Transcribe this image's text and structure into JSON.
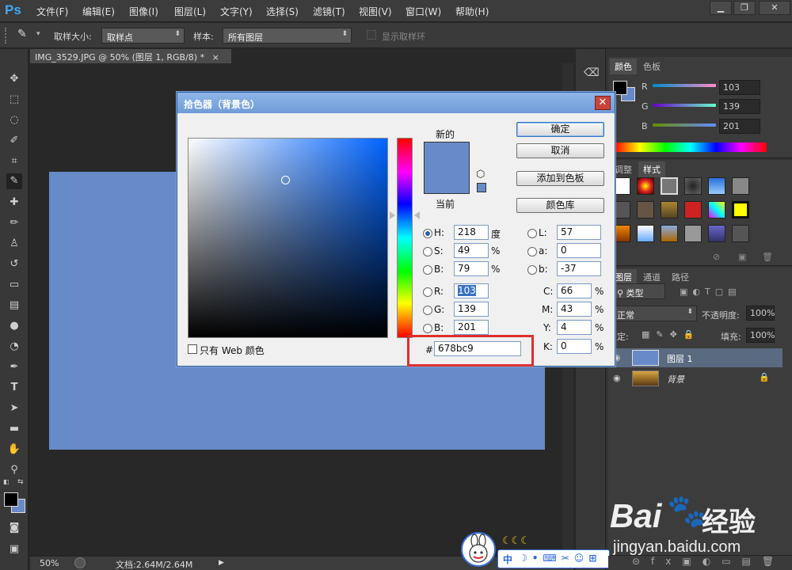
{
  "app": {
    "logo": "Ps",
    "menu": [
      "文件(F)",
      "编辑(E)",
      "图像(I)",
      "图层(L)",
      "文字(Y)",
      "选择(S)",
      "滤镜(T)",
      "视图(V)",
      "窗口(W)",
      "帮助(H)"
    ],
    "window_buttons": [
      "▁",
      "❐",
      "✕"
    ]
  },
  "options_bar": {
    "sample_size_label": "取样大小:",
    "sample_size_value": "取样点",
    "sample_label": "样本:",
    "sample_value": "所有图层",
    "show_ring_label": "显示取样环"
  },
  "document": {
    "tab_title": "IMG_3529.JPG @ 50% (图层 1, RGB/8) *",
    "tab_close": "×",
    "fill_color": "#678bc9",
    "zoom": "50%",
    "doc_info": "文档:2.64M/2.64M"
  },
  "color_panel": {
    "tabs": [
      "颜色",
      "色板"
    ],
    "channels": [
      {
        "label": "R",
        "value": "103"
      },
      {
        "label": "G",
        "value": "139"
      },
      {
        "label": "B",
        "value": "201"
      }
    ]
  },
  "styles_panel": {
    "tabs": [
      "调整",
      "样式"
    ]
  },
  "layers_panel": {
    "tabs": [
      "图层",
      "通道",
      "路径"
    ],
    "filter": "类型",
    "blend_mode": "正常",
    "opacity_label": "不透明度:",
    "opacity": "100%",
    "lock_label": "锁定:",
    "fill_label": "填充:",
    "fill": "100%",
    "layers": [
      {
        "name": "图层 1",
        "selected": true
      },
      {
        "name": "背景",
        "selected": false
      }
    ]
  },
  "color_picker": {
    "title": "拾色器（背景色）",
    "close": "✕",
    "new_label": "新的",
    "current_label": "当前",
    "new_color": "#678bc9",
    "current_color": "#678bc9",
    "buttons": {
      "ok": "确定",
      "cancel": "取消",
      "add_swatch": "添加到色板",
      "color_library": "颜色库"
    },
    "hsb": [
      {
        "label": "H:",
        "value": "218",
        "unit": "度",
        "selected": true
      },
      {
        "label": "S:",
        "value": "49",
        "unit": "%",
        "selected": false
      },
      {
        "label": "B:",
        "value": "79",
        "unit": "%",
        "selected": false
      }
    ],
    "rgb": [
      {
        "label": "R:",
        "value": "103"
      },
      {
        "label": "G:",
        "value": "139"
      },
      {
        "label": "B:",
        "value": "201"
      }
    ],
    "lab": [
      {
        "label": "L:",
        "value": "57"
      },
      {
        "label": "a:",
        "value": "0"
      },
      {
        "label": "b:",
        "value": "-37"
      }
    ],
    "cmyk": [
      {
        "label": "C:",
        "value": "66",
        "unit": "%"
      },
      {
        "label": "M:",
        "value": "43",
        "unit": "%"
      },
      {
        "label": "Y:",
        "value": "4",
        "unit": "%"
      },
      {
        "label": "K:",
        "value": "0",
        "unit": "%"
      }
    ],
    "hex_label": "#",
    "hex": "678bc9",
    "web_only_label": "只有 Web 颜色"
  },
  "watermark": {
    "ime_text": "中",
    "baidu_text": "Bai",
    "baidu_cn": "经验",
    "url": "jingyan.baidu.com"
  }
}
